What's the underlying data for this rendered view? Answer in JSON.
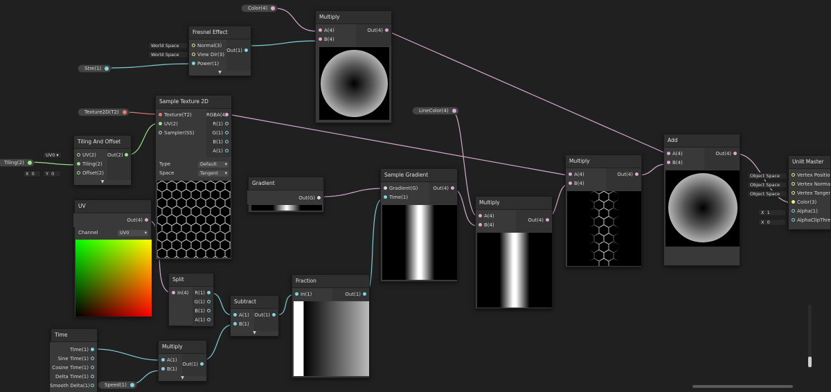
{
  "canvas": {
    "background": "#202020"
  },
  "colors": {
    "vec4_port": "#e0a8d0",
    "vec1_port": "#84d4e4",
    "vec2_port": "#98e488",
    "vec3_port": "#f0f07c",
    "texture_port": "#e87878",
    "wire_vector": "#d9a9d2",
    "wire_float": "#7fcfdc",
    "wire_uv": "#9be28c",
    "wire_texture": "#e47a7a"
  },
  "properties": {
    "color": "Color(4)",
    "stre": "Stre(1)",
    "texture": "Texture2D(T2)",
    "tiling": "Tiling(2)",
    "line_color": "LineColor(4)",
    "speed": "Speed(1)"
  },
  "nodes": {
    "fresnel": {
      "title": "Fresnel Effect",
      "inputs": [
        "Normal(3)",
        "View Dir(3)",
        "Power(1)"
      ],
      "outputs": [
        "Out(1)"
      ],
      "defaults": [
        "World Space",
        "World Space"
      ]
    },
    "multiply_top": {
      "title": "Multiply",
      "inputs": [
        "A(4)",
        "B(4)"
      ],
      "outputs": [
        "Out(4)"
      ]
    },
    "sample_texture": {
      "title": "Sample Texture 2D",
      "inputs": [
        "Texture(T2)",
        "UV(2)",
        "Sampler(SS)"
      ],
      "outputs": [
        "RGBA(4)",
        "R(1)",
        "G(1)",
        "B(1)",
        "A(1)"
      ],
      "type_label": "Type",
      "type_value": "Default",
      "space_label": "Space",
      "space_value": "Tangent"
    },
    "tiling_offset": {
      "title": "Tiling And Offset",
      "inputs": [
        "UV(2)",
        "Tiling(2)",
        "Offset(2)"
      ],
      "outputs": [
        "Out(2)"
      ],
      "uv_default": "UV0",
      "offset_x_label": "X",
      "offset_x": "0",
      "offset_y_label": "Y",
      "offset_y": "0"
    },
    "uv": {
      "title": "UV",
      "outputs": [
        "Out(4)"
      ],
      "channel_label": "Channel",
      "channel_value": "UV0"
    },
    "gradient": {
      "title": "Gradient",
      "outputs": [
        "Out(G)"
      ]
    },
    "sample_gradient": {
      "title": "Sample Gradient",
      "inputs": [
        "Gradient(G)",
        "Time(1)"
      ],
      "outputs": [
        "Out(4)"
      ]
    },
    "multiply_mid": {
      "title": "Multiply",
      "inputs": [
        "A(4)",
        "B(4)"
      ],
      "outputs": [
        "Out(4)"
      ]
    },
    "multiply_right": {
      "title": "Multiply",
      "inputs": [
        "A(4)",
        "B(4)"
      ],
      "outputs": [
        "Out(4)"
      ]
    },
    "add": {
      "title": "Add",
      "inputs": [
        "A(4)",
        "B(4)"
      ],
      "outputs": [
        "Out(4)"
      ]
    },
    "unlit_master": {
      "title": "Unlit Master",
      "inputs": [
        "Vertex Position(3)",
        "Vertex Normal(3)",
        "Vertex Tangent(3)",
        "Color(3)",
        "Alpha(1)",
        "AlphaClipThreshold(1)"
      ],
      "space_defaults": [
        "Object Space",
        "Object Space",
        "Object Space"
      ],
      "alpha_label": "X",
      "alpha_value": "1",
      "clip_label": "X",
      "clip_value": "0"
    },
    "split": {
      "title": "Split",
      "inputs": [
        "In(4)"
      ],
      "outputs": [
        "R(1)",
        "G(1)",
        "B(1)",
        "A(1)"
      ]
    },
    "subtract": {
      "title": "Subtract",
      "inputs": [
        "A(1)",
        "B(1)"
      ],
      "outputs": [
        "Out(1)"
      ]
    },
    "fraction": {
      "title": "Fraction",
      "inputs": [
        "In(1)"
      ],
      "outputs": [
        "Out(1)"
      ]
    },
    "time": {
      "title": "Time",
      "outputs": [
        "Time(1)",
        "Sine Time(1)",
        "Cosine Time(1)",
        "Delta Time(1)",
        "Smooth Delta(1)"
      ]
    },
    "multiply_bottom": {
      "title": "Multiply",
      "inputs": [
        "A(1)",
        "B(1)"
      ],
      "outputs": [
        "Out(1)"
      ]
    }
  }
}
